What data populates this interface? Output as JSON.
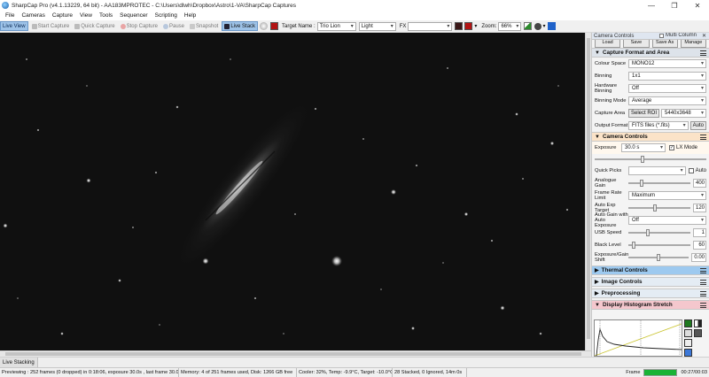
{
  "window": {
    "title": "SharpCap Pro (v4.1.13229, 64 bit) - AA183MPROTEC - C:\\Users\\dlwh\\Dropbox\\Astro\\1-VA\\SharpCap Captures",
    "minimize": "—",
    "maximize": "❐",
    "close": "✕"
  },
  "menu": [
    "File",
    "Cameras",
    "Capture",
    "View",
    "Tools",
    "Sequencer",
    "Scripting",
    "Help"
  ],
  "toolbar": {
    "live_view": "Live View",
    "start_capture": "Start Capture",
    "quick_capture": "Quick Capture",
    "stop_capture": "Stop Capture",
    "pause": "Pause",
    "snapshot": "Snapshot",
    "live_stack": "Live Stack",
    "target_name_label": "Target Name :",
    "target_name_value": "Trio Lion",
    "frame_type": "Light",
    "fx_label": "FX",
    "fx_value": "",
    "zoom_label": "Zoom:",
    "zoom_value": "66%"
  },
  "sidebar": {
    "header": "Camera Controls",
    "multi_column": "Multi Column",
    "stub_buttons": [
      "Load",
      "Save",
      "Save As",
      "Manage"
    ],
    "capture_format": {
      "title": "Capture Format and Area",
      "colour_space_label": "Colour Space",
      "colour_space": "MONO12",
      "binning_label": "Binning",
      "binning": "1x1",
      "hw_binning_label": "Hardware Binning",
      "hw_binning": "Off",
      "binning_mode_label": "Binning Mode",
      "binning_mode": "Average",
      "capture_area_label": "Capture Area",
      "select_roi": "Select ROI",
      "capture_area": "5440x3648",
      "output_format_label": "Output Format",
      "output_format": "FITS files (*.fits)",
      "auto": "Auto"
    },
    "camera_controls": {
      "title": "Camera Controls",
      "exposure_label": "Exposure",
      "exposure": "30.0 s",
      "lx_mode": "LX Mode",
      "quick_picks_label": "Quick Picks",
      "quick_picks_auto": "Auto",
      "analogue_gain_label": "Analogue Gain",
      "analogue_gain": "400",
      "analogue_gain_level": 0.2,
      "frame_rate_label": "Frame Rate Limit",
      "frame_rate": "Maximum",
      "auto_exp_target_label": "Auto Exp Target",
      "auto_exp_target": "120",
      "auto_exp_target_level": 0.42,
      "auto_gain_label": "Auto Gain with Auto Exposure",
      "auto_gain": "Off",
      "usb_speed_label": "USB Speed",
      "usb_speed": "1",
      "usb_speed_level": 0.3,
      "black_level_label": "Black Level",
      "black_level": "60",
      "black_level_level": 0.06,
      "exposure_gain_shift_label": "Exposure/Gain Shift",
      "exposure_gain_shift": "0.00",
      "exposure_gain_shift_level": 0.5
    },
    "sections": {
      "thermal": "Thermal Controls",
      "image": "Image Controls",
      "preprocessing": "Preprocessing",
      "histogram": "Display Histogram Stretch"
    }
  },
  "status": {
    "tab": "Live Stacking",
    "previewing": "Previewing : 252 frames (0 dropped) in 0:18:06, exposure 30.0s , last frame 30.0s",
    "memory": "Memory: 4 of 251 frames used, Disk: 1266 GB free",
    "cooler": "Cooler: 32%, Temp: -9.9°C, Target: -10.0°C",
    "stacked": "28 Stacked, 0 Ignored, 14m 0s",
    "frame_label": "Frame",
    "frame_progress": 1.0,
    "frame_time": "00:27/00:03"
  },
  "colors": {
    "accent": "#9ec3e8",
    "camera_section": "#fbe3c8",
    "thermal_section": "#9dc9ef",
    "histogram_section": "#f4c7cd",
    "progress_fill": "#19b336"
  },
  "icons": [
    "live-view-icon",
    "start-capture-icon",
    "quick-capture-icon",
    "stop-capture-icon",
    "pause-icon",
    "snapshot-icon",
    "live-stack-icon",
    "gear-icon",
    "histogram-tool-icons"
  ]
}
